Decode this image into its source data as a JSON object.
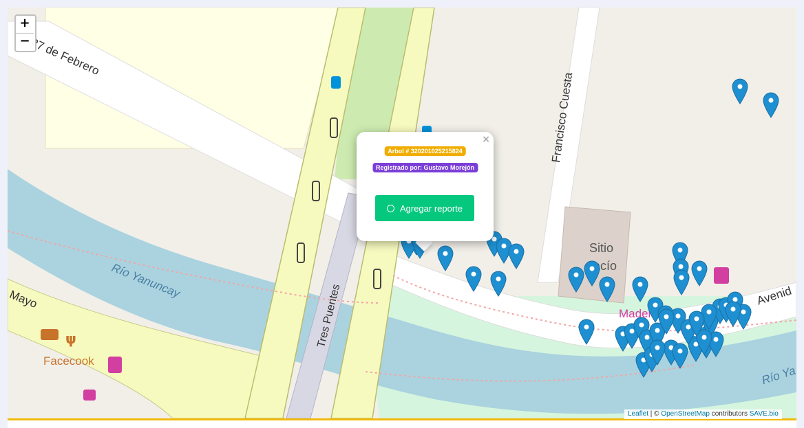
{
  "zoom": {
    "in_label": "+",
    "out_label": "−"
  },
  "map_labels": {
    "street_feb": "27 de Febrero",
    "street_cuesta": "Francisco Cuesta",
    "street_mayo": "Mayo",
    "street_tres_puentes": "Tres Puentes",
    "street_avenida": "Avenid",
    "river_yanuncay": "Río Yanuncay",
    "river_right": "Río Ya",
    "sitio_line1": "Sitio",
    "sitio_line2": "vacío",
    "poi_facecook": "Facecook",
    "poi_maderera": "Maderería"
  },
  "popup": {
    "close_label": "×",
    "tree_badge": "Arbol # 320201025215824",
    "registered_by": "Registrado por: Gustavo Morejón",
    "report_button": "Agregar reporte"
  },
  "attribution": {
    "leaflet": "Leaflet",
    "separator": " | © ",
    "osm": "OpenStreetMap",
    "contributors": " contributors ",
    "savebio": "SAVE.bio"
  },
  "colors": {
    "marker": "#1e8fd0",
    "tree_badge": "#f0ad00",
    "user_badge": "#7b3fd8",
    "report_button": "#06c77e",
    "bottom_accent": "#f0b90b"
  },
  "icons": [
    "plus-icon",
    "minus-icon",
    "map-marker-icon",
    "close-icon",
    "comment-icon",
    "bus-stop-icon",
    "traffic-light-icon",
    "restaurant-icon",
    "shop-icon"
  ]
}
